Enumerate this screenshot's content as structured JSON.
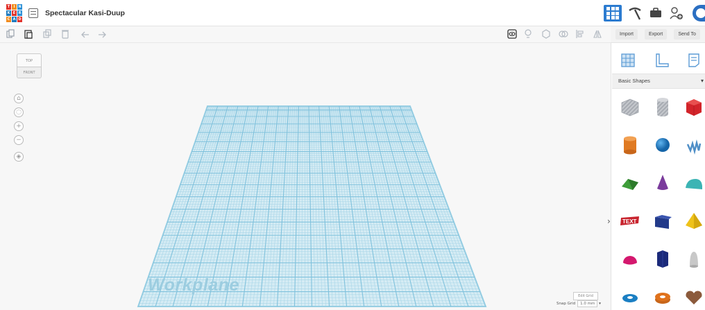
{
  "app": {
    "logo_letters": [
      "TIN",
      "KER",
      "CAD"
    ],
    "title": "Spectacular Kasi-Duup"
  },
  "header_right": {
    "view_3d_icon": "grid-3d-icon",
    "icons": [
      "pickaxe-icon",
      "briefcase-icon",
      "add-user-icon",
      "avatar"
    ]
  },
  "toolbar": {
    "tools": [
      {
        "name": "copy-icon"
      },
      {
        "name": "paste-icon"
      },
      {
        "name": "duplicate-icon"
      },
      {
        "name": "delete-icon"
      },
      {
        "name": "undo-icon"
      },
      {
        "name": "redo-icon"
      },
      {
        "name": "show-all-icon"
      },
      {
        "name": "lightbulb-icon"
      },
      {
        "name": "group-icon"
      },
      {
        "name": "ungroup-icon"
      },
      {
        "name": "align-icon"
      },
      {
        "name": "mirror-icon"
      }
    ]
  },
  "side_actions": {
    "import": "Import",
    "export": "Export",
    "send_to": "Send To"
  },
  "viewcube": {
    "top": "TOP",
    "front": "FRONT"
  },
  "nav_controls": [
    "home-icon",
    "fit-view-icon",
    "zoom-in-icon",
    "zoom-out-icon",
    "perspective-icon"
  ],
  "workplane": {
    "label": "Workplane",
    "color": "#a8d8ea"
  },
  "grid_controls": {
    "edit_grid": "Edit Grid",
    "snap_label": "Snap Grid",
    "snap_value": "1.0 mm"
  },
  "panel": {
    "tabs": [
      "workplane-tab-icon",
      "ruler-tab-icon",
      "notes-tab-icon"
    ],
    "category": "Basic Shapes",
    "shapes": [
      {
        "name": "box-hole",
        "color": "#b9bcc2"
      },
      {
        "name": "cylinder-hole",
        "color": "#b9bcc2"
      },
      {
        "name": "box",
        "color": "#d2242a"
      },
      {
        "name": "cylinder",
        "color": "#e07a22"
      },
      {
        "name": "sphere",
        "color": "#1e7ec7"
      },
      {
        "name": "scribble",
        "color": "#6aa4d4"
      },
      {
        "name": "roof",
        "color": "#3e9d3a"
      },
      {
        "name": "cone",
        "color": "#7a3b9c"
      },
      {
        "name": "round-roof",
        "color": "#3cb4b4"
      },
      {
        "name": "text",
        "color": "#c8242e"
      },
      {
        "name": "wedge",
        "color": "#223a8a"
      },
      {
        "name": "pyramid",
        "color": "#eec21a"
      },
      {
        "name": "half-sphere",
        "color": "#d4186e"
      },
      {
        "name": "polygon",
        "color": "#1b2a7a"
      },
      {
        "name": "paraboloid",
        "color": "#c8c8c8"
      },
      {
        "name": "torus",
        "color": "#1b7fc3"
      },
      {
        "name": "tube",
        "color": "#e0721c"
      },
      {
        "name": "heart",
        "color": "#8b5a3c"
      }
    ]
  }
}
